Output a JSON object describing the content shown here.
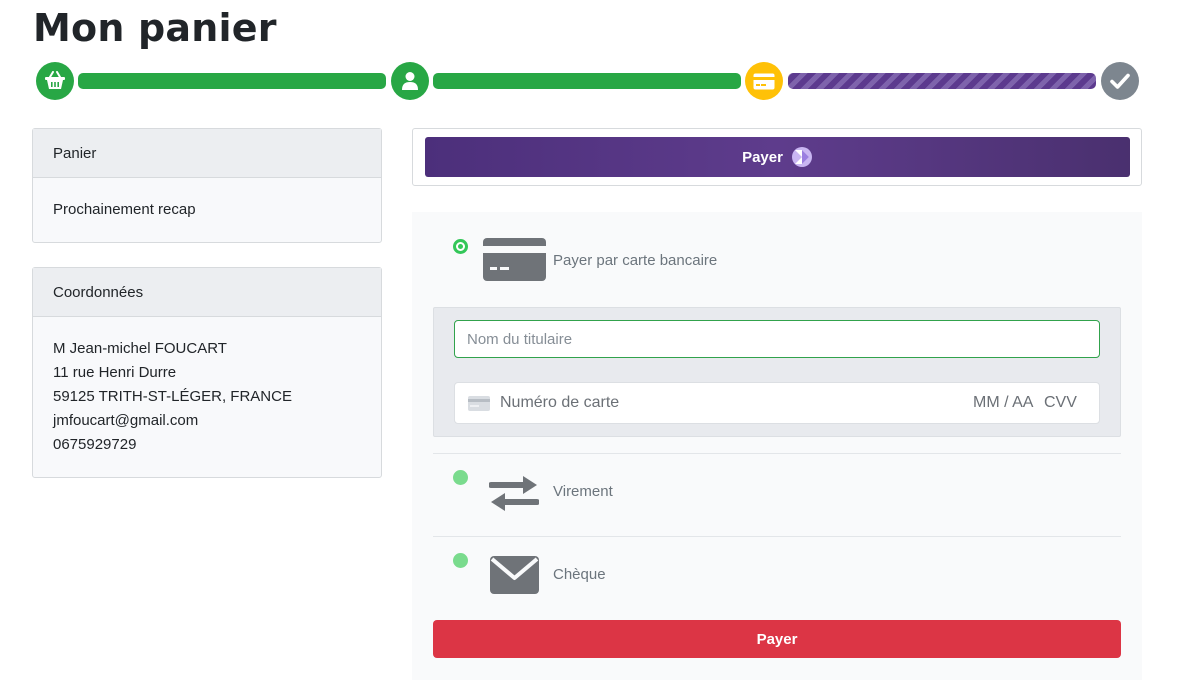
{
  "page": {
    "title": "Mon panier"
  },
  "stepper": {
    "steps": [
      {
        "icon": "basket-icon",
        "state": "done",
        "color": "#28a745"
      },
      {
        "icon": "user-icon",
        "state": "done",
        "color": "#28a745"
      },
      {
        "icon": "credit-card-icon",
        "state": "current",
        "color": "#ffc107"
      },
      {
        "icon": "check-icon",
        "state": "pending",
        "color": "#7d868f"
      }
    ],
    "bar_colors": {
      "done": "#28a745",
      "current": "#5c3a8e"
    }
  },
  "cart_card": {
    "header": "Panier",
    "body": "Prochainement recap"
  },
  "contact_card": {
    "header": "Coordonnées",
    "lines": [
      "M Jean-michel FOUCART",
      "11 rue Henri Durre",
      "59125 TRITH-ST-LÉGER, FRANCE",
      "jmfoucart@gmail.com",
      "0675929729"
    ]
  },
  "express_pay": {
    "label": "Payer",
    "icon": "chevron-logo-icon",
    "color": "#4c2f7b"
  },
  "payment_methods": [
    {
      "label": "Payer par carte bancaire",
      "icon": "credit-card-icon",
      "selected": true
    },
    {
      "label": "Virement",
      "icon": "transfer-arrows-icon",
      "selected": false
    },
    {
      "label": "Chèque",
      "icon": "envelope-icon",
      "selected": false
    }
  ],
  "card_form": {
    "holder_placeholder": "Nom du titulaire",
    "holder_value": "",
    "number_placeholder": "Numéro de carte",
    "expiry_placeholder": "MM / AA",
    "cvv_placeholder": "CVV"
  },
  "submit": {
    "label": "Payer",
    "color": "#dc3545"
  },
  "colors": {
    "success": "#28a745",
    "warning": "#ffc107",
    "danger": "#dc3545",
    "purple": "#5c3a8e"
  }
}
